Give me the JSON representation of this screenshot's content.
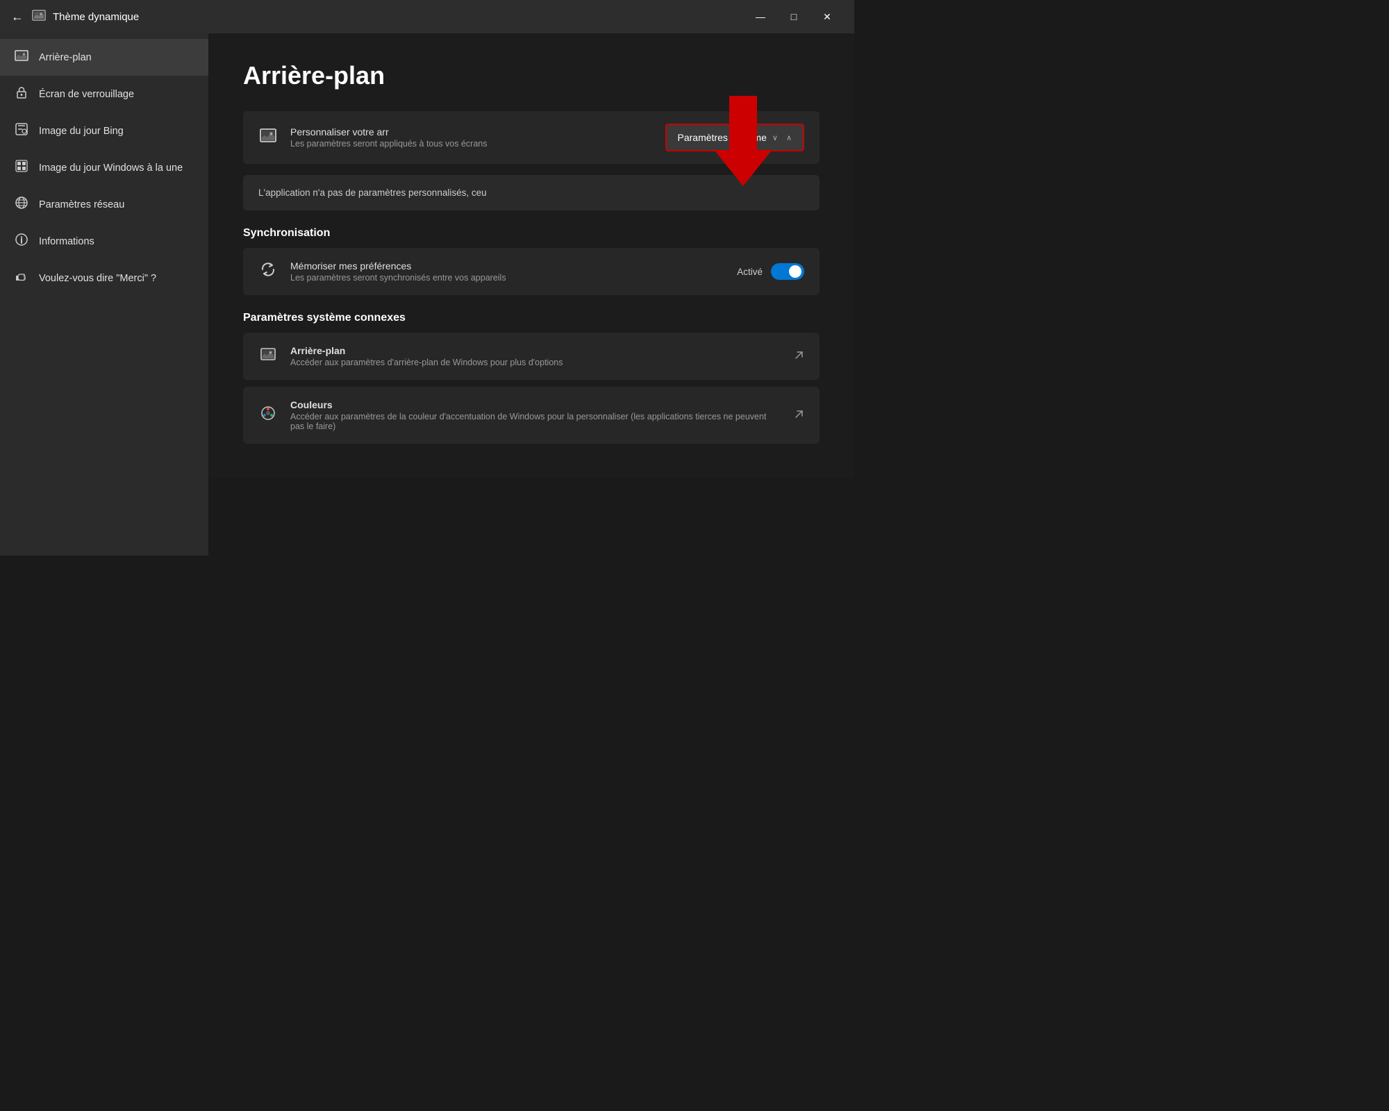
{
  "titleBar": {
    "back_label": "←",
    "icon_label": "🖼",
    "title": "Thème dynamique",
    "minimize_label": "—",
    "maximize_label": "□",
    "close_label": "✕"
  },
  "sidebar": {
    "items": [
      {
        "id": "arriere-plan",
        "icon": "🖼",
        "label": "Arrière-plan",
        "active": true
      },
      {
        "id": "ecran-verrouillage",
        "icon": "🔒",
        "label": "Écran de verrouillage",
        "active": false
      },
      {
        "id": "image-bing",
        "icon": "🎁",
        "label": "Image du jour Bing",
        "active": false
      },
      {
        "id": "image-windows",
        "icon": "🏷",
        "label": "Image du jour Windows à la une",
        "active": false
      },
      {
        "id": "parametres-reseau",
        "icon": "🌐",
        "label": "Paramètres réseau",
        "active": false
      },
      {
        "id": "informations",
        "icon": "ℹ",
        "label": "Informations",
        "active": false
      },
      {
        "id": "merci",
        "icon": "👍",
        "label": "Voulez-vous dire \"Merci\" ?",
        "active": false
      }
    ]
  },
  "main": {
    "pageTitle": "Arrière-plan",
    "personalizeSection": {
      "icon": "🖼",
      "title": "Personnaliser votre arr",
      "subtitle": "Les paramètres seront appliqués à tous vos écrans",
      "dropdown_label": "Paramètres système",
      "dropdown_chevron": "∨",
      "dropdown_chevron_up": "∧"
    },
    "infoMessage": "L'application n'a pas de paramètres personnalisés, ceu",
    "synchronisation": {
      "sectionLabel": "Synchronisation",
      "icon": "🔄",
      "title": "Mémoriser mes préférences",
      "subtitle": "Les paramètres seront synchronisés entre vos appareils",
      "toggle_label": "Activé",
      "toggle_on": true
    },
    "relatedSettings": {
      "sectionLabel": "Paramètres système connexes",
      "items": [
        {
          "icon": "🖼",
          "title": "Arrière-plan",
          "subtitle": "Accéder aux paramètres d'arrière-plan de Windows pour plus d'options"
        },
        {
          "icon": "🎨",
          "title": "Couleurs",
          "subtitle": "Accéder aux paramètres de la couleur d'accentuation de Windows pour la personnaliser (les applications tierces ne peuvent pas le faire)"
        }
      ]
    }
  }
}
